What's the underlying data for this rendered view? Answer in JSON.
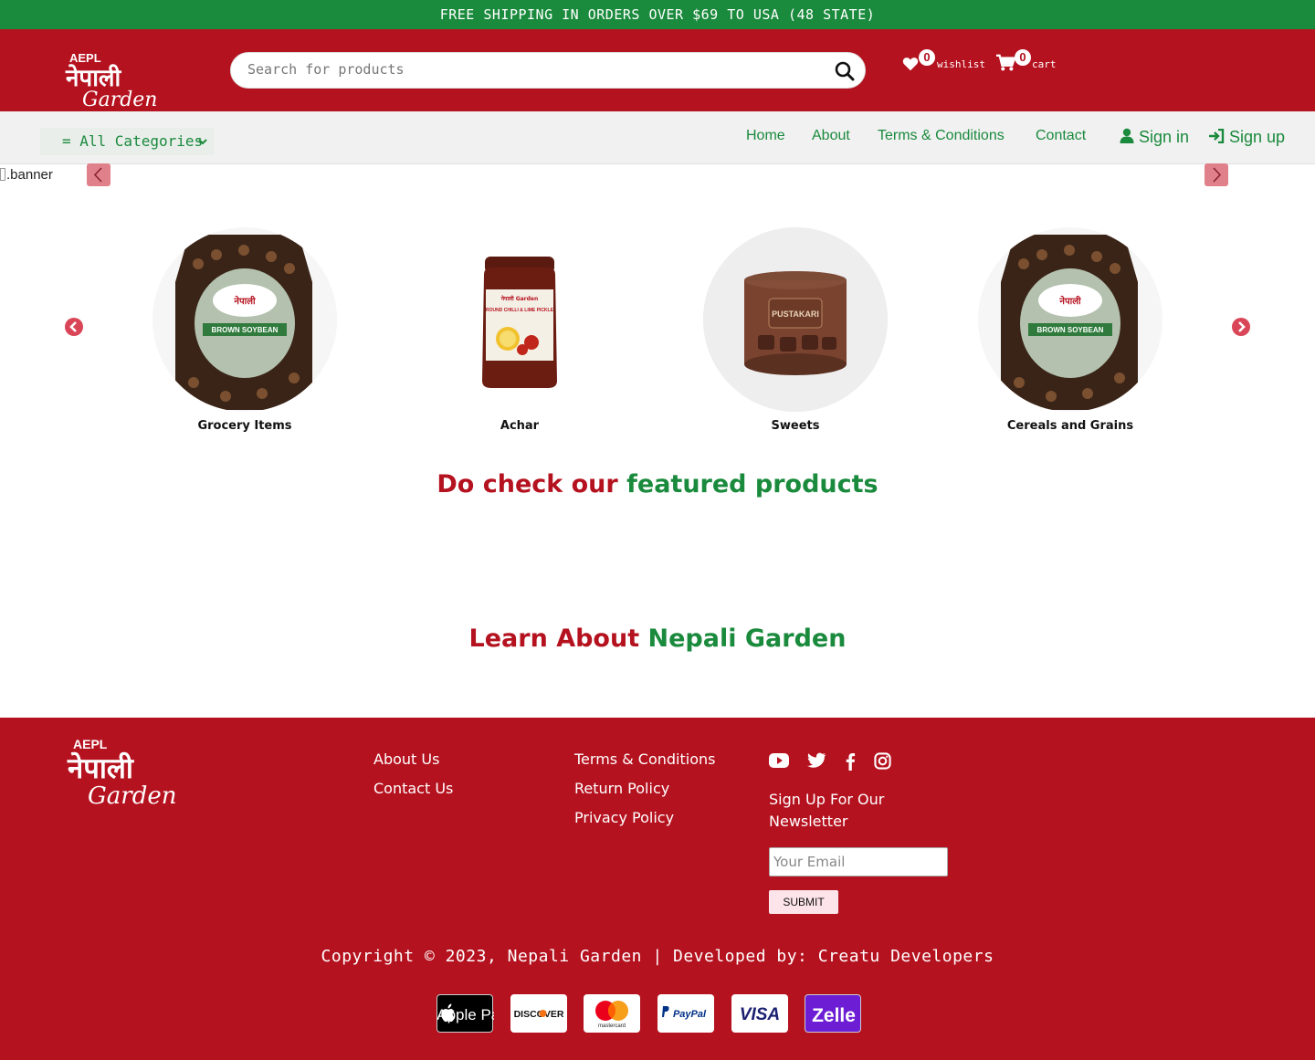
{
  "topbar": {
    "text": "FREE SHIPPING IN ORDERS OVER $69 TO USA (48 STATE)"
  },
  "header": {
    "logo_top": "AEPL",
    "logo_nepali": "नेपाली",
    "logo_garden": "Garden",
    "search_placeholder": "Search for products",
    "wishlist_count": "0",
    "wishlist_label": "wishlist",
    "cart_count": "0",
    "cart_label": "cart"
  },
  "nav": {
    "category_select": "= All Categories",
    "links": [
      "Home",
      "About",
      "Terms & Conditions",
      "Contact"
    ],
    "sign_in": "Sign in",
    "sign_up": "Sign up"
  },
  "banner": {
    "alt_text": ".banner"
  },
  "categories": [
    {
      "name": "Grocery Items",
      "pack_label": "BROWN SOYBEAN"
    },
    {
      "name": "Achar",
      "pack_label": "ROUND CHILLI & LIME PICKLE"
    },
    {
      "name": "Sweets",
      "pack_label": "PUSTAKARI"
    },
    {
      "name": "Cereals and Grains",
      "pack_label": "BROWN SOYBEAN"
    }
  ],
  "featured": {
    "part1": "Do check our",
    "part2": "featured products"
  },
  "learn": {
    "part1": "Learn About",
    "part2": "Nepali Garden"
  },
  "footer": {
    "col1": [
      "About Us",
      "Contact Us"
    ],
    "col2": [
      "Terms & Conditions",
      "Return Policy",
      "Privacy Policy"
    ],
    "newsletter_title": "Sign Up For Our Newsletter",
    "email_placeholder": "Your Email",
    "submit_label": "SUBMIT",
    "copyright": "Copyright © 2023, Nepali Garden | Developed by: Creatu Developers",
    "payments": [
      "Apple Pay",
      "DISCOVER",
      "mastercard",
      "PayPal",
      "VISA",
      "Zelle"
    ]
  },
  "colors": {
    "brand_red": "#b5121f",
    "brand_green": "#1a8a3d"
  }
}
